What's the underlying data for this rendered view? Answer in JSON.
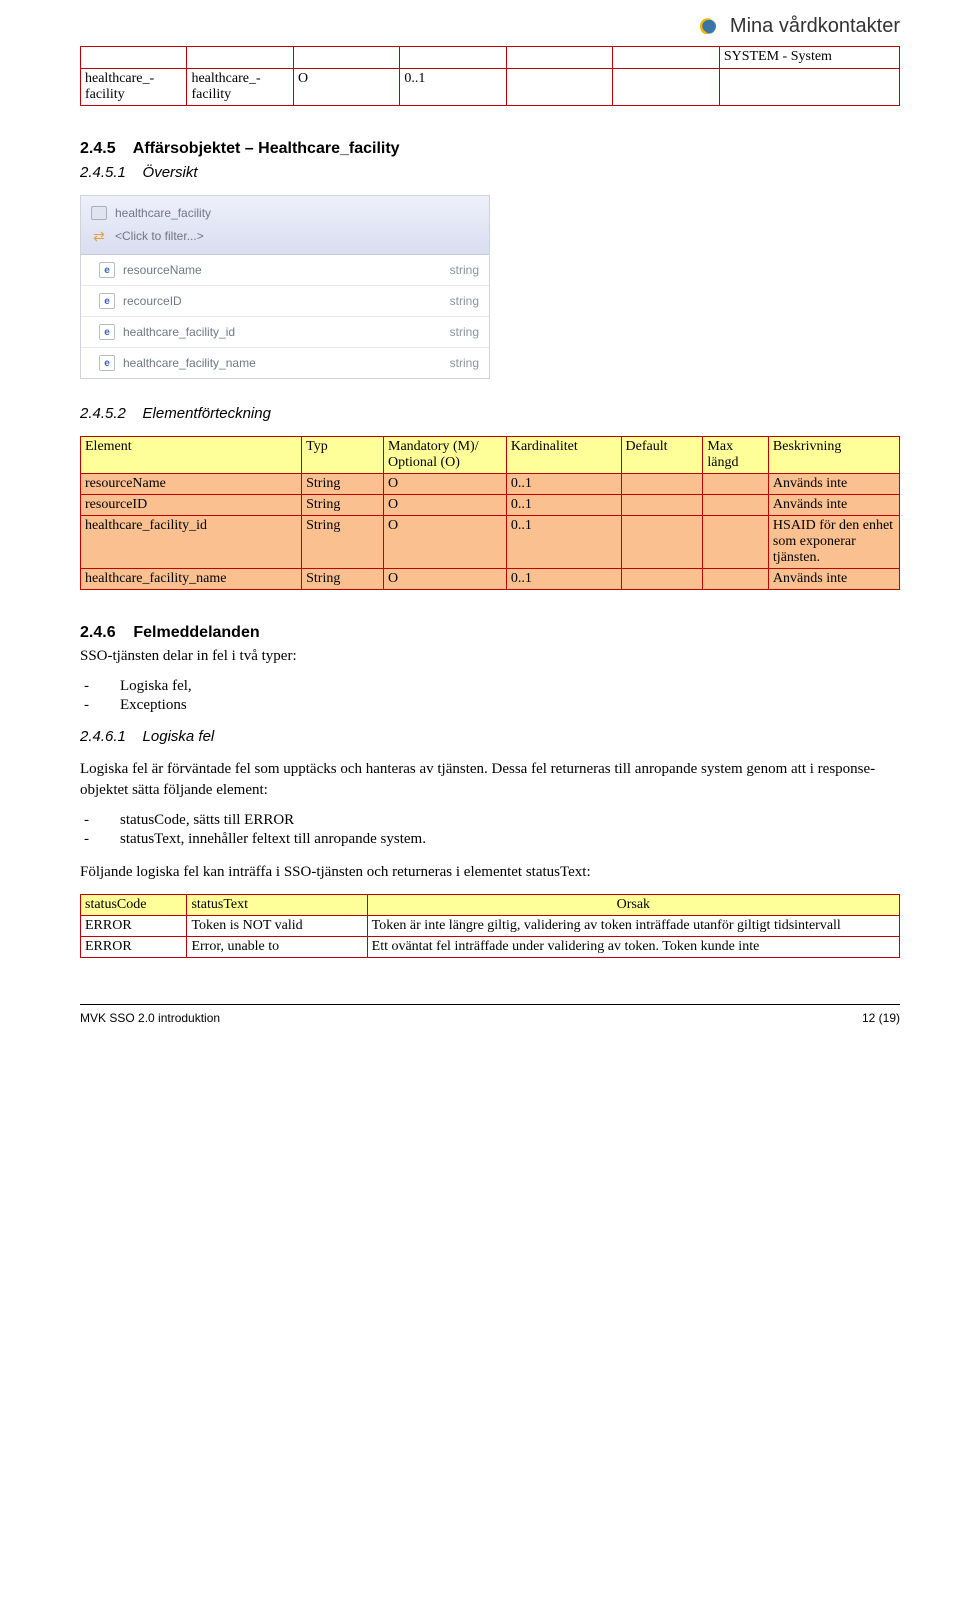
{
  "brand": "Mina vårdkontakter",
  "topFragment": {
    "lastCell": "SYSTEM - System",
    "row": [
      "healthcare_-facility",
      "healthcare_-facility",
      "O",
      "0..1",
      "",
      "",
      ""
    ]
  },
  "s245": {
    "num": "2.4.5",
    "title": "Affärsobjektet – Healthcare_facility",
    "sub1num": "2.4.5.1",
    "sub1title": "Översikt",
    "sub2num": "2.4.5.2",
    "sub2title": "Elementförteckning"
  },
  "panel": {
    "title": "healthcare_facility",
    "filter": "<Click to filter...>",
    "items": [
      {
        "name": "resourceName",
        "type": "string"
      },
      {
        "name": "recourceID",
        "type": "string"
      },
      {
        "name": "healthcare_facility_id",
        "type": "string"
      },
      {
        "name": "healthcare_facility_name",
        "type": "string"
      }
    ]
  },
  "elemHeader": [
    "Element",
    "Typ",
    "Mandatory (M)/ Optional (O)",
    "Kardinalitet",
    "Default",
    "Max längd",
    "Beskrivning"
  ],
  "elemRows": [
    [
      "resourceName",
      "String",
      "O",
      "0..1",
      "",
      "",
      "Används inte"
    ],
    [
      "resourceID",
      "String",
      "O",
      "0..1",
      "",
      "",
      "Används inte"
    ],
    [
      "healthcare_facility_id",
      "String",
      "O",
      "0..1",
      "",
      "",
      "HSAID för den enhet som exponerar tjänsten."
    ],
    [
      "healthcare_facility_name",
      "String",
      "O",
      "0..1",
      "",
      "",
      "Används inte"
    ]
  ],
  "s246": {
    "num": "2.4.6",
    "title": "Felmeddelanden",
    "intro": "SSO-tjänsten delar in fel i två typer:",
    "bullets": [
      "Logiska fel,",
      "Exceptions"
    ]
  },
  "s2461": {
    "num": "2.4.6.1",
    "title": "Logiska fel",
    "p1": "Logiska fel är förväntade fel som upptäcks och hanteras av tjänsten. Dessa fel returneras till anropande system genom att i response-objektet sätta följande element:",
    "bullets": [
      "statusCode, sätts till ERROR",
      "statusText, innehåller feltext till anropande system."
    ],
    "p2": "Följande logiska fel kan inträffa i SSO-tjänsten och returneras i elementet statusText:"
  },
  "errHeader": [
    "statusCode",
    "statusText",
    "Orsak"
  ],
  "errRows": [
    [
      "ERROR",
      "Token is NOT valid",
      "Token är inte längre giltig, validering av token inträffade utanför giltigt tidsintervall"
    ],
    [
      "ERROR",
      "Error, unable to",
      "Ett oväntat fel inträffade under validering av token. Token kunde inte"
    ]
  ],
  "footer": {
    "left": "MVK SSO 2.0 introduktion",
    "right": "12 (19)"
  }
}
